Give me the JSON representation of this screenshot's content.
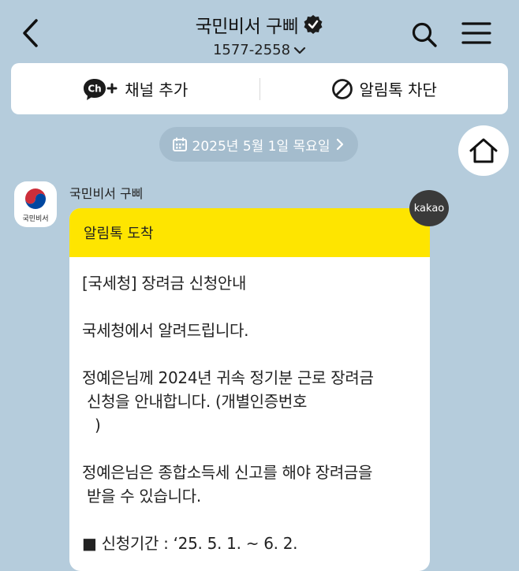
{
  "header": {
    "title": "국민비서 구삐",
    "phone": "1577-2558"
  },
  "actions": {
    "add_channel": "채널 추가",
    "block_alimtalk": "알림톡 차단"
  },
  "date_divider": "2025년 5월 1일 목요일",
  "message": {
    "sender": "국민비서 구삐",
    "avatar_label": "국민비서",
    "badge": "kakao",
    "header_label": "알림톡 도착",
    "lines": {
      "l1": "[국세청] 장려금 신청안내",
      "l2": "국세청에서 알려드립니다.",
      "l3a": "정예은님께 2024년 귀속 정기분 근로 장려금",
      "l3b": "신청을 안내합니다. (개별인증번호",
      "l3c": ")",
      "l4a": "정예은님은 종합소득세 신고를 해야 장려금을",
      "l4b": "받을 수 있습니다.",
      "l5": "■ 신청기간 : ‘25. 5. 1. ~ 6. 2."
    }
  },
  "colors": {
    "background": "#b5ccdc",
    "alimtalk_yellow": "#fee500",
    "date_pill": "#a4bccd"
  },
  "icons": [
    "back-arrow-icon",
    "verified-badge-icon",
    "chevron-down-icon",
    "search-icon",
    "menu-icon",
    "channel-plus-icon",
    "block-icon",
    "calendar-icon",
    "chevron-right-icon",
    "home-icon"
  ]
}
